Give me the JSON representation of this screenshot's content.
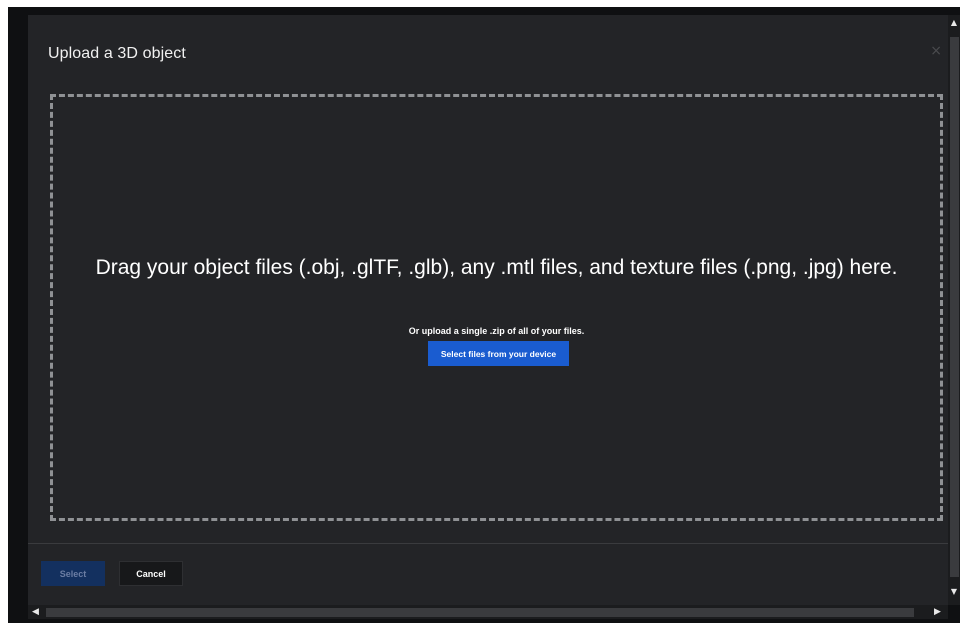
{
  "dialog": {
    "title": "Upload a 3D object",
    "close_glyph": "×"
  },
  "dropzone": {
    "headline": "Drag your object files (.obj, .glTF, .glb), any .mtl files, and texture files (.png, .jpg) here.",
    "subtext": "Or upload a single .zip of all of your files.",
    "select_button_label": "Select files from your device"
  },
  "footer": {
    "select_label": "Select",
    "cancel_label": "Cancel"
  },
  "scrollbars": {
    "up_arrow": "▲",
    "down_arrow": "▼",
    "left_arrow": "◀",
    "right_arrow": "▶"
  },
  "colors": {
    "dialog_background": "#232427",
    "primary_button": "#1a5cd0",
    "disabled_primary": "#13305f",
    "dropzone_border": "#8f9194"
  },
  "icons": [
    "close-icon",
    "scroll-up-icon",
    "scroll-down-icon",
    "scroll-left-icon",
    "scroll-right-icon"
  ]
}
